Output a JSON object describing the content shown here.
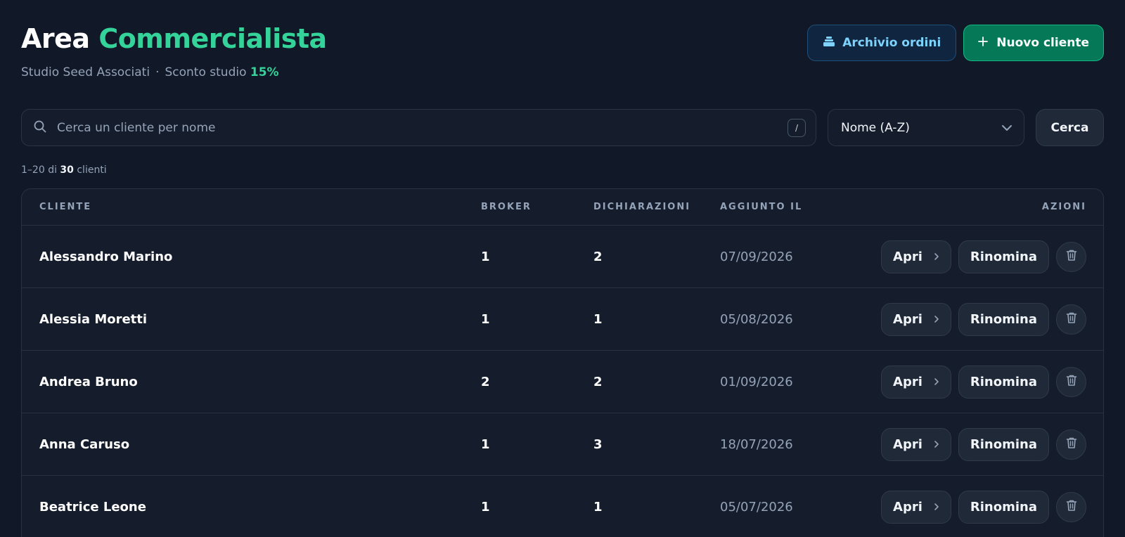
{
  "header": {
    "title_prefix": "Area",
    "title_accent": "Commercialista",
    "studio_name": "Studio Seed Associati",
    "separator": "·",
    "discount_label": "Sconto studio",
    "discount_value": "15%"
  },
  "actions": {
    "archive_label": "Archivio ordini",
    "new_client_label": "Nuovo cliente"
  },
  "search": {
    "placeholder": "Cerca un cliente per nome",
    "shortcut": "/",
    "sort_selected": "Nome (A-Z)",
    "submit_label": "Cerca"
  },
  "results": {
    "range": "1–20",
    "of": "di",
    "total": "30",
    "unit": "clienti"
  },
  "table": {
    "columns": {
      "cliente": "CLIENTE",
      "broker": "BROKER",
      "dichiarazioni": "DICHIARAZIONI",
      "aggiunto": "AGGIUNTO IL",
      "azioni": "AZIONI"
    },
    "open_label": "Apri",
    "rename_label": "Rinomina",
    "rows": [
      {
        "name": "Alessandro Marino",
        "broker": "1",
        "dichiarazioni": "2",
        "date": "07/09/2026"
      },
      {
        "name": "Alessia Moretti",
        "broker": "1",
        "dichiarazioni": "1",
        "date": "05/08/2026"
      },
      {
        "name": "Andrea Bruno",
        "broker": "2",
        "dichiarazioni": "2",
        "date": "01/09/2026"
      },
      {
        "name": "Anna Caruso",
        "broker": "1",
        "dichiarazioni": "3",
        "date": "18/07/2026"
      },
      {
        "name": "Beatrice Leone",
        "broker": "1",
        "dichiarazioni": "1",
        "date": "05/07/2026"
      }
    ]
  },
  "colors": {
    "background": "#111827",
    "accent": "#34d399",
    "primary_button": "#047857",
    "archive_text": "#7dd3fc"
  },
  "icons": {
    "archive": "tray-stack-icon",
    "plus": "plus-icon",
    "search": "search-icon",
    "chevron_down": "chevron-down-icon",
    "chevron_right": "chevron-right-icon",
    "trash": "trash-icon"
  }
}
